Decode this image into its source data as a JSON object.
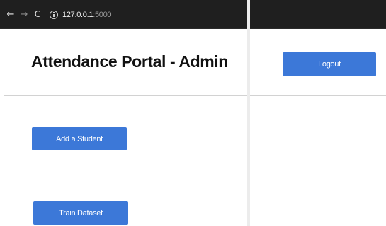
{
  "browser": {
    "url_host": "127.0.0.1",
    "url_port": ":5000",
    "back_glyph": "←",
    "forward_glyph": "→",
    "reload_glyph": "C"
  },
  "page": {
    "title": "Attendance Portal - Admin"
  },
  "actions": {
    "add_student_label": "Add a Student",
    "train_dataset_label": "Train Dataset",
    "logout_label": "Logout"
  },
  "colors": {
    "button": "#3c78d8",
    "chrome": "#1f1f1f"
  }
}
